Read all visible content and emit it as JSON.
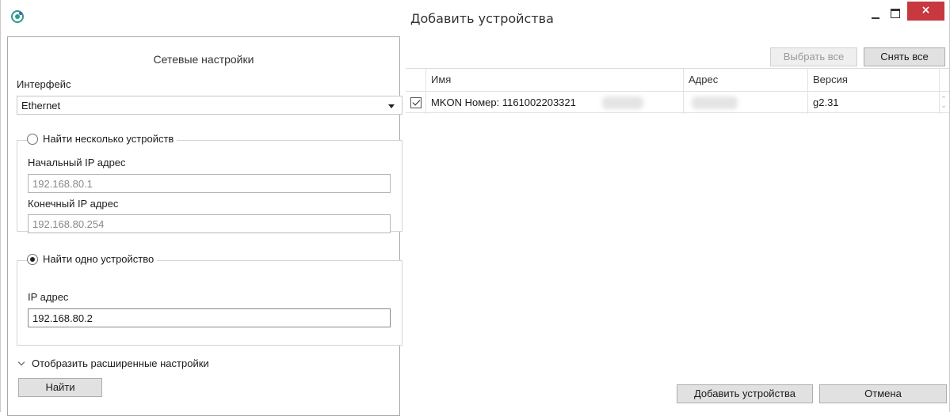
{
  "window": {
    "title": "Добавить устройства",
    "close_glyph": "×"
  },
  "left": {
    "section_title": "Сетевые настройки",
    "interface_label": "Интерфейс",
    "interface_value": "Ethernet",
    "multi": {
      "radio_label": "Найти несколько устройств",
      "start_label": "Начальный IP адрес",
      "start_value": "192.168.80.1",
      "end_label": "Конечный IP адрес",
      "end_value": "192.168.80.254",
      "selected": false
    },
    "single": {
      "radio_label": "Найти одно устройство",
      "ip_label": "IP адрес",
      "ip_value": "192.168.80.2",
      "selected": true
    },
    "advanced_label": "Отобразить расширенные настройки",
    "find_button": "Найти"
  },
  "right": {
    "select_all_button": "Выбрать все",
    "deselect_all_button": "Снять все",
    "columns": [
      "Имя",
      "Адрес",
      "Версия"
    ],
    "rows": [
      {
        "checked": true,
        "name": "MKON Номер: 1161002203321",
        "address": "",
        "version": "g2.31"
      }
    ],
    "add_button": "Добавить устройства",
    "cancel_button": "Отмена"
  },
  "colors": {
    "close_button": "#c7383f",
    "button_bg": "#e1e1e1"
  },
  "icons": [
    "app-icon",
    "minimize-icon",
    "maximize-icon",
    "close-icon",
    "chevron-down-icon",
    "checkbox-checked-icon"
  ]
}
